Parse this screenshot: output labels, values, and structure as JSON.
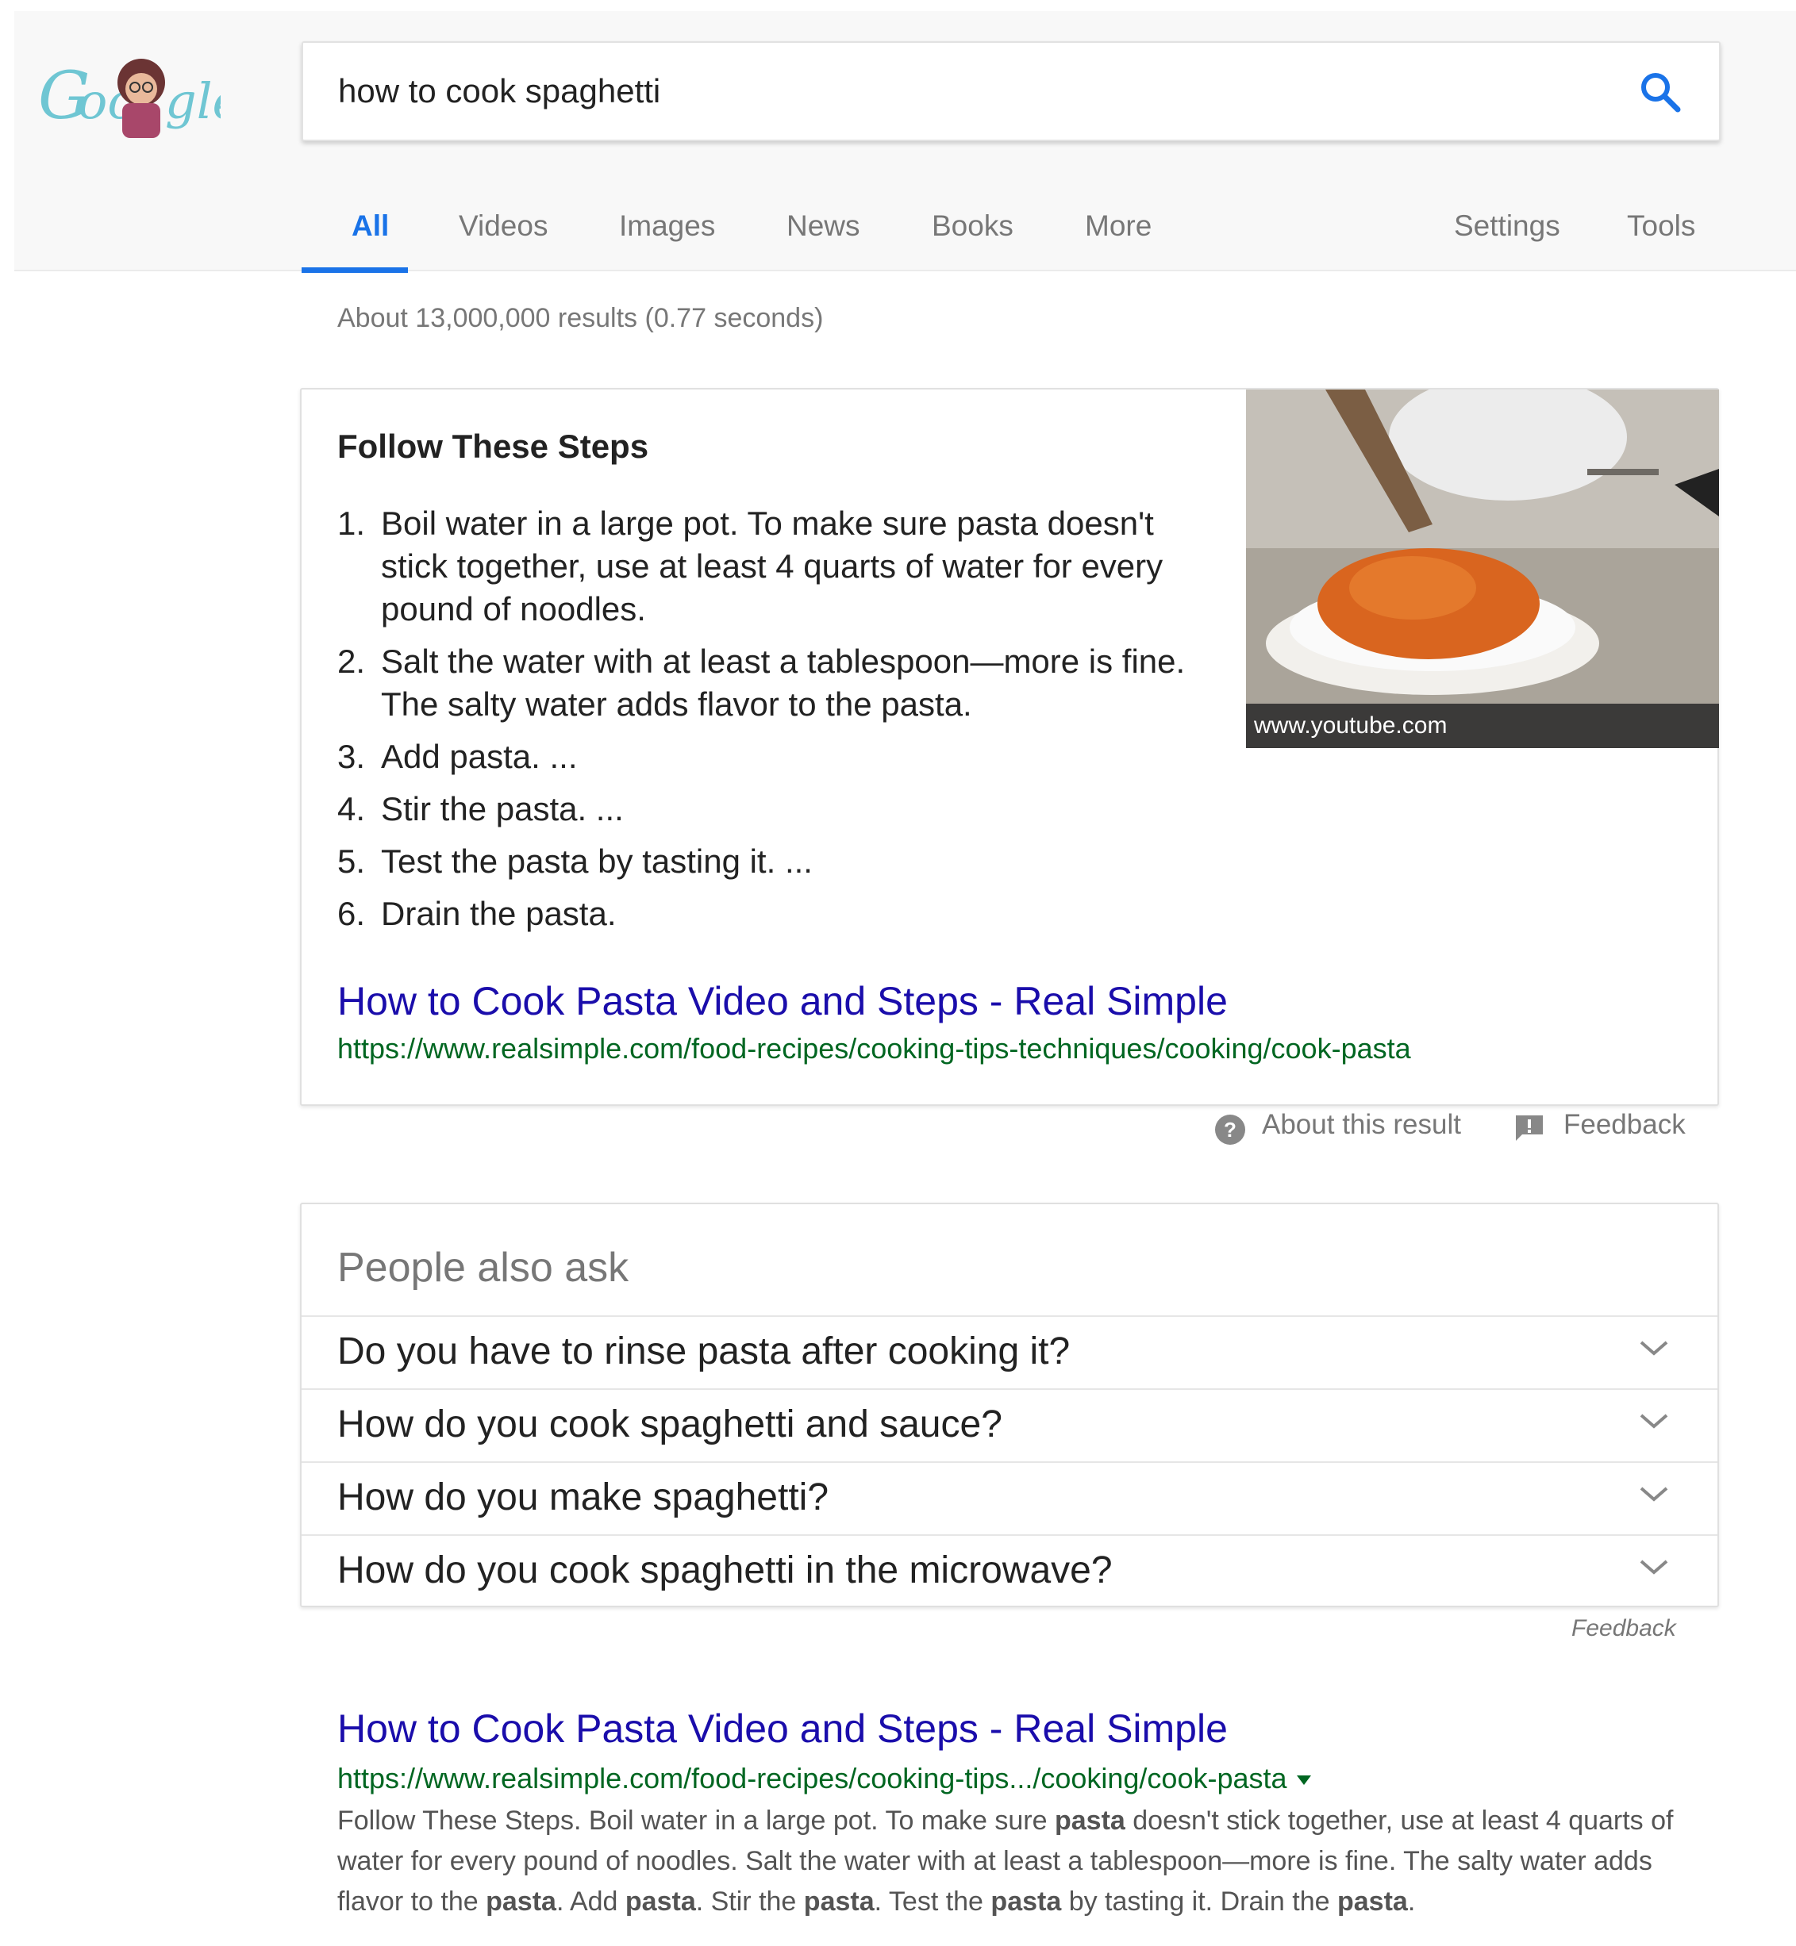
{
  "search": {
    "query": "how to cook spaghetti"
  },
  "tabs": [
    {
      "label": "All",
      "active": true
    },
    {
      "label": "Videos"
    },
    {
      "label": "Images"
    },
    {
      "label": "News"
    },
    {
      "label": "Books"
    },
    {
      "label": "More"
    },
    {
      "label": "Settings"
    },
    {
      "label": "Tools"
    }
  ],
  "results_stats": "About 13,000,000 results (0.77 seconds)",
  "featured_snippet": {
    "heading": "Follow These Steps",
    "steps": [
      {
        "num": "1.",
        "text": "Boil water in a large pot. To make sure pasta doesn't stick together, use at least 4 quarts of water for every pound of noodles."
      },
      {
        "num": "2.",
        "text": "Salt the water with at least a tablespoon—more is fine. The salty water adds flavor to the pasta."
      },
      {
        "num": "3.",
        "text": "Add pasta. ..."
      },
      {
        "num": "4.",
        "text": "Stir the pasta. ..."
      },
      {
        "num": "5.",
        "text": "Test the pasta by tasting it. ..."
      },
      {
        "num": "6.",
        "text": "Drain the pasta."
      }
    ],
    "image_caption": "www.youtube.com",
    "title": "How to Cook Pasta Video and Steps - Real Simple",
    "url": "https://www.realsimple.com/food-recipes/cooking-tips-techniques/cooking/cook-pasta"
  },
  "about_row": {
    "about_label": "About this result",
    "feedback_label": "Feedback"
  },
  "people_also_ask": {
    "heading": "People also ask",
    "questions": [
      "Do you have to rinse pasta after cooking it?",
      "How do you cook spaghetti and sauce?",
      "How do you make spaghetti?",
      "How do you cook spaghetti in the microwave?"
    ],
    "feedback_label": "Feedback"
  },
  "result": {
    "title": "How to Cook Pasta Video and Steps - Real Simple",
    "url": "https://www.realsimple.com/food-recipes/cooking-tips.../cooking/cook-pasta",
    "snippet_parts": [
      "Follow These Steps. Boil water in a large pot. To make sure ",
      "pasta",
      " doesn't stick together, use at least 4 quarts of water for every pound of noodles. Salt the water with at least a tablespoon—more is fine. The salty water adds flavor to the ",
      "pasta",
      ". Add ",
      "pasta",
      ". Stir the ",
      "pasta",
      ". Test the ",
      "pasta",
      " by tasting it. Drain the ",
      "pasta",
      "."
    ]
  },
  "colors": {
    "link": "#1a0dab",
    "url": "#006621",
    "accent": "#1a73e8",
    "muted": "#777777"
  },
  "icons": {
    "logo": "google-doodle-logo",
    "search": "search-icon",
    "help": "help-circle-icon",
    "feedback": "feedback-flag-icon",
    "chevron": "chevron-down-icon"
  }
}
